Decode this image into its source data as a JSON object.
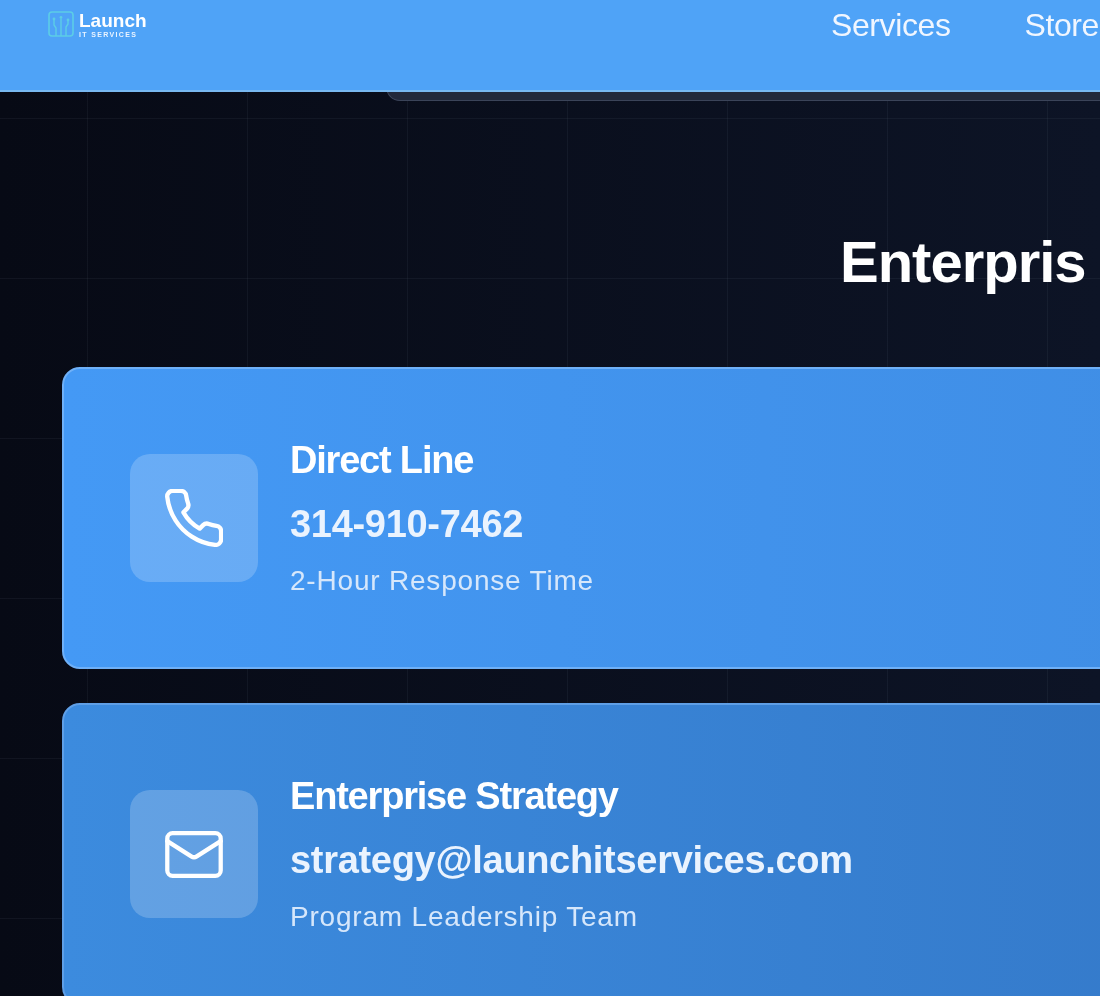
{
  "header": {
    "logo": {
      "name": "Launch",
      "tagline": "IT SERVICES"
    },
    "nav": [
      {
        "label": "Services"
      },
      {
        "label": "Store"
      }
    ]
  },
  "heading": "Enterpris",
  "contact_cards": [
    {
      "kind": "phone",
      "title": "Direct Line",
      "value": "314-910-7462",
      "note": "2-Hour Response Time"
    },
    {
      "kind": "email",
      "title": "Enterprise Strategy",
      "value": "strategy@launchitservices.com",
      "note": "Program Leadership Team"
    }
  ]
}
